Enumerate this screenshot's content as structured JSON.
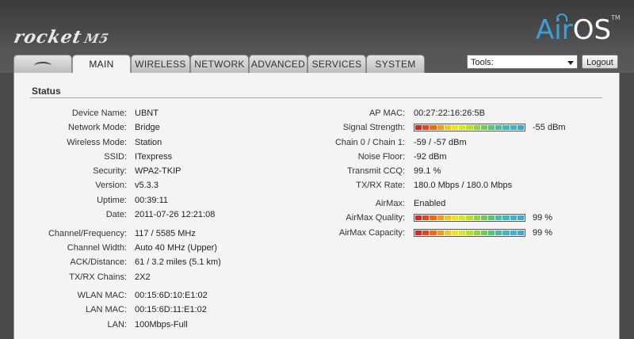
{
  "header": {
    "device_logo": "rocket",
    "device_model": "M5",
    "brand_air": "Air",
    "brand_os": "OS",
    "brand_tm": "TM"
  },
  "tabs": [
    {
      "label": "",
      "icon": "ubiquiti-antenna-icon"
    },
    {
      "label": "MAIN"
    },
    {
      "label": "WIRELESS"
    },
    {
      "label": "NETWORK"
    },
    {
      "label": "ADVANCED"
    },
    {
      "label": "SERVICES"
    },
    {
      "label": "SYSTEM"
    }
  ],
  "tools": {
    "selected": "Tools:"
  },
  "logout_label": "Logout",
  "status": {
    "title": "Status",
    "left": [
      {
        "label": "Device Name:",
        "value": "UBNT"
      },
      {
        "label": "Network Mode:",
        "value": "Bridge"
      },
      {
        "label": "Wireless Mode:",
        "value": "Station"
      },
      {
        "label": "SSID:",
        "value": "ITexpress"
      },
      {
        "label": "Security:",
        "value": "WPA2-TKIP"
      },
      {
        "label": "Version:",
        "value": "v5.3.3"
      },
      {
        "label": "Uptime:",
        "value": "00:39:11"
      },
      {
        "label": "Date:",
        "value": "2011-07-26 12:21:08"
      },
      {
        "label": "Channel/Frequency:",
        "value": "117  /  5585 MHz"
      },
      {
        "label": "Channel Width:",
        "value": "Auto 40 MHz  (Upper)"
      },
      {
        "label": "ACK/Distance:",
        "value": "61 / 3.2 miles (5.1 km)"
      },
      {
        "label": "TX/RX Chains:",
        "value": "2X2"
      },
      {
        "label": "WLAN MAC:",
        "value": "00:15:6D:10:E1:02"
      },
      {
        "label": "LAN MAC:",
        "value": "00:15:6D:11:E1:02"
      },
      {
        "label": "LAN:",
        "value": "100Mbps-Full"
      }
    ],
    "right": {
      "ap_mac": {
        "label": "AP MAC:",
        "value": "00:27:22:16:26:5B"
      },
      "signal_strength": {
        "label": "Signal Strength:",
        "value": "-55 dBm",
        "level": 1.0
      },
      "chains": {
        "label": "Chain 0 / Chain 1:",
        "value": "-59  /  -57  dBm"
      },
      "noise_floor": {
        "label": "Noise Floor:",
        "value": "-92 dBm"
      },
      "transmit_ccq": {
        "label": "Transmit CCQ:",
        "value": "99.1 %"
      },
      "txrx_rate": {
        "label": "TX/RX Rate:",
        "value": "180.0 Mbps  /  180.0 Mbps"
      },
      "airmax": {
        "label": "AirMax:",
        "value": "Enabled"
      },
      "airmax_quality": {
        "label": "AirMax Quality:",
        "value": "99  %",
        "level": 0.99
      },
      "airmax_capacity": {
        "label": "AirMax Capacity:",
        "value": "99  %",
        "level": 0.99
      }
    }
  },
  "colors": {
    "meter_segments": [
      "#d92a1c",
      "#e8451a",
      "#ef6b1a",
      "#f39a1a",
      "#f6c31a",
      "#f2e21a",
      "#d7e81c",
      "#b5e02a",
      "#8fd63a",
      "#6dcd55",
      "#52c679",
      "#45c09b",
      "#3fbab8",
      "#3bb2cf",
      "#38a8de"
    ]
  }
}
